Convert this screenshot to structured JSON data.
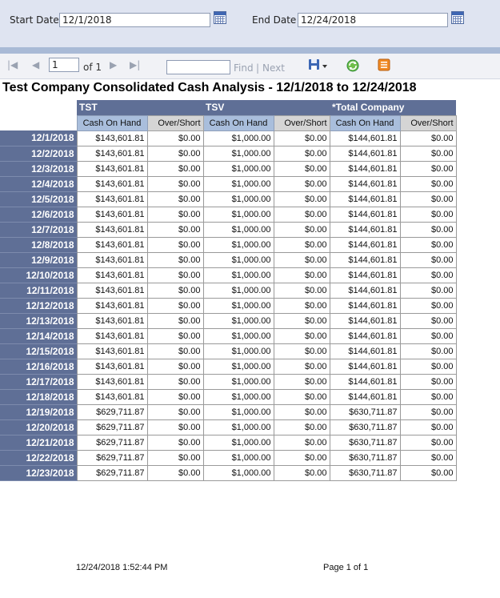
{
  "params": {
    "start_label": "Start Date",
    "start_value": "12/1/2018",
    "end_label": "End Date",
    "end_value": "12/24/2018"
  },
  "toolbar": {
    "first_glyph": "|◀",
    "prev_glyph": "◀",
    "page_value": "1",
    "of_text": "of 1",
    "next_glyph": "▶",
    "last_glyph": "▶|",
    "find_value": "",
    "find_label": "Find",
    "divider": "|",
    "next_label": "Next"
  },
  "report": {
    "title": "Test Company Consolidated Cash Analysis - 12/1/2018 to 12/24/2018",
    "groups": [
      "TST",
      "TSV",
      "*Total Company"
    ],
    "col_cash": "Cash On Hand",
    "col_os": "Over/Short",
    "rows": [
      {
        "date": "12/1/2018",
        "v": [
          "$143,601.81",
          "$0.00",
          "$1,000.00",
          "$0.00",
          "$144,601.81",
          "$0.00"
        ]
      },
      {
        "date": "12/2/2018",
        "v": [
          "$143,601.81",
          "$0.00",
          "$1,000.00",
          "$0.00",
          "$144,601.81",
          "$0.00"
        ]
      },
      {
        "date": "12/3/2018",
        "v": [
          "$143,601.81",
          "$0.00",
          "$1,000.00",
          "$0.00",
          "$144,601.81",
          "$0.00"
        ]
      },
      {
        "date": "12/4/2018",
        "v": [
          "$143,601.81",
          "$0.00",
          "$1,000.00",
          "$0.00",
          "$144,601.81",
          "$0.00"
        ]
      },
      {
        "date": "12/5/2018",
        "v": [
          "$143,601.81",
          "$0.00",
          "$1,000.00",
          "$0.00",
          "$144,601.81",
          "$0.00"
        ]
      },
      {
        "date": "12/6/2018",
        "v": [
          "$143,601.81",
          "$0.00",
          "$1,000.00",
          "$0.00",
          "$144,601.81",
          "$0.00"
        ]
      },
      {
        "date": "12/7/2018",
        "v": [
          "$143,601.81",
          "$0.00",
          "$1,000.00",
          "$0.00",
          "$144,601.81",
          "$0.00"
        ]
      },
      {
        "date": "12/8/2018",
        "v": [
          "$143,601.81",
          "$0.00",
          "$1,000.00",
          "$0.00",
          "$144,601.81",
          "$0.00"
        ]
      },
      {
        "date": "12/9/2018",
        "v": [
          "$143,601.81",
          "$0.00",
          "$1,000.00",
          "$0.00",
          "$144,601.81",
          "$0.00"
        ]
      },
      {
        "date": "12/10/2018",
        "v": [
          "$143,601.81",
          "$0.00",
          "$1,000.00",
          "$0.00",
          "$144,601.81",
          "$0.00"
        ]
      },
      {
        "date": "12/11/2018",
        "v": [
          "$143,601.81",
          "$0.00",
          "$1,000.00",
          "$0.00",
          "$144,601.81",
          "$0.00"
        ]
      },
      {
        "date": "12/12/2018",
        "v": [
          "$143,601.81",
          "$0.00",
          "$1,000.00",
          "$0.00",
          "$144,601.81",
          "$0.00"
        ]
      },
      {
        "date": "12/13/2018",
        "v": [
          "$143,601.81",
          "$0.00",
          "$1,000.00",
          "$0.00",
          "$144,601.81",
          "$0.00"
        ]
      },
      {
        "date": "12/14/2018",
        "v": [
          "$143,601.81",
          "$0.00",
          "$1,000.00",
          "$0.00",
          "$144,601.81",
          "$0.00"
        ]
      },
      {
        "date": "12/15/2018",
        "v": [
          "$143,601.81",
          "$0.00",
          "$1,000.00",
          "$0.00",
          "$144,601.81",
          "$0.00"
        ]
      },
      {
        "date": "12/16/2018",
        "v": [
          "$143,601.81",
          "$0.00",
          "$1,000.00",
          "$0.00",
          "$144,601.81",
          "$0.00"
        ]
      },
      {
        "date": "12/17/2018",
        "v": [
          "$143,601.81",
          "$0.00",
          "$1,000.00",
          "$0.00",
          "$144,601.81",
          "$0.00"
        ]
      },
      {
        "date": "12/18/2018",
        "v": [
          "$143,601.81",
          "$0.00",
          "$1,000.00",
          "$0.00",
          "$144,601.81",
          "$0.00"
        ]
      },
      {
        "date": "12/19/2018",
        "v": [
          "$629,711.87",
          "$0.00",
          "$1,000.00",
          "$0.00",
          "$630,711.87",
          "$0.00"
        ]
      },
      {
        "date": "12/20/2018",
        "v": [
          "$629,711.87",
          "$0.00",
          "$1,000.00",
          "$0.00",
          "$630,711.87",
          "$0.00"
        ]
      },
      {
        "date": "12/21/2018",
        "v": [
          "$629,711.87",
          "$0.00",
          "$1,000.00",
          "$0.00",
          "$630,711.87",
          "$0.00"
        ]
      },
      {
        "date": "12/22/2018",
        "v": [
          "$629,711.87",
          "$0.00",
          "$1,000.00",
          "$0.00",
          "$630,711.87",
          "$0.00"
        ]
      },
      {
        "date": "12/23/2018",
        "v": [
          "$629,711.87",
          "$0.00",
          "$1,000.00",
          "$0.00",
          "$630,711.87",
          "$0.00"
        ]
      }
    ]
  },
  "footer": {
    "timestamp": "12/24/2018 1:52:44 PM",
    "page": "Page 1 of 1"
  },
  "icons": {
    "calendar": "calendar-icon",
    "export": "save-export-icon",
    "refresh": "refresh-icon",
    "print": "print-icon"
  }
}
